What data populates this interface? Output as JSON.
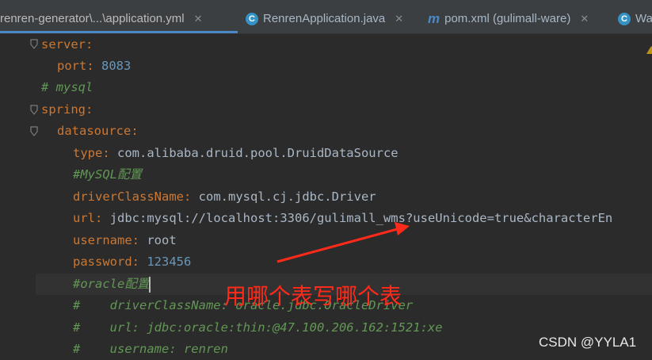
{
  "tabs": [
    {
      "label": "renren-generator\\...\\application.yml",
      "icon": "yaml-icon",
      "active": true
    },
    {
      "label": "RenrenApplication.java",
      "icon": "java-class-icon",
      "active": false
    },
    {
      "label": "pom.xml (gulimall-ware)",
      "icon": "maven-icon",
      "active": false
    },
    {
      "label": "Wa",
      "icon": "java-class-icon",
      "active": false
    }
  ],
  "icon_letters": {
    "class": "C",
    "maven": "m"
  },
  "code": {
    "l1_key": "server",
    "l2_key": "port",
    "l2_val": "8083",
    "l3_comment": "# mysql",
    "l4_key": "spring",
    "l5_key": "datasource",
    "l6_key": "type",
    "l6_val": "com.alibaba.druid.pool.DruidDataSource",
    "l7_comment": "#MySQL配置",
    "l8_key": "driverClassName",
    "l8_val": "com.mysql.cj.jdbc.Driver",
    "l9_key": "url",
    "l9_val": "jdbc:mysql://localhost:3306/gulimall_wms?useUnicode=true&characterEn",
    "l10_key": "username",
    "l10_val": "root",
    "l11_key": "password",
    "l11_val": "123456",
    "l12_comment": "#oracle配置",
    "l13_comment": "#    driverClassName: oracle.jdbc.OracleDriver",
    "l14_comment": "#    url: jdbc:oracle:thin:@47.100.206.162:1521:xe",
    "l15_comment": "#    username: renren"
  },
  "colon": ":",
  "annotation_text": "用哪个表写哪个表",
  "watermark": "CSDN @YYLA1",
  "colors": {
    "background": "#2b2b2b",
    "keyword": "#cc7832",
    "number": "#6897bb",
    "comment": "#629755",
    "annotation": "#ff2a1a",
    "tab_underline": "#4a88c7"
  }
}
